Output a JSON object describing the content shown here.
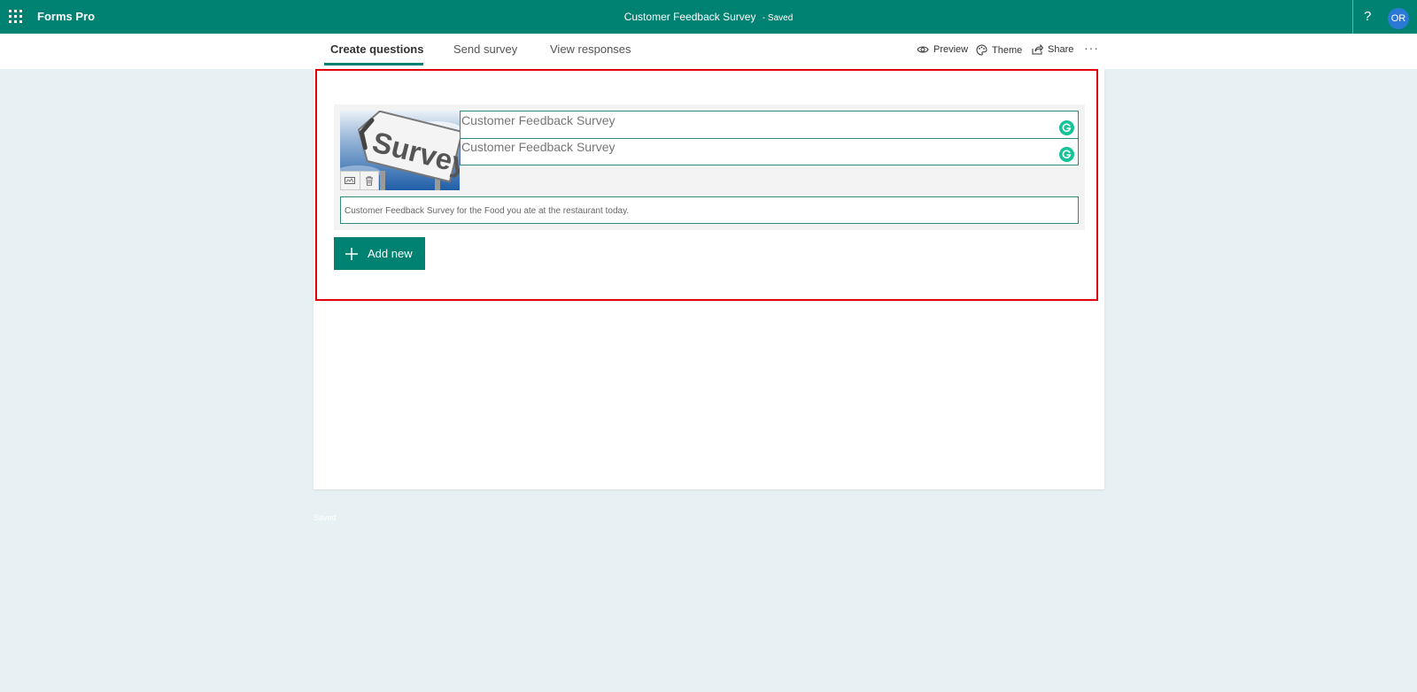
{
  "app": {
    "name": "Forms Pro"
  },
  "header": {
    "survey_title": "Customer Feedback Survey",
    "separator": "-",
    "save_status": "Saved"
  },
  "user": {
    "initials": "OR"
  },
  "help": {
    "label": "?"
  },
  "tabs": [
    {
      "label": "Create questions",
      "active": true
    },
    {
      "label": "Send survey",
      "active": false
    },
    {
      "label": "View responses",
      "active": false
    }
  ],
  "actions": {
    "preview": "Preview",
    "theme": "Theme",
    "share": "Share",
    "more": "···"
  },
  "survey": {
    "title": "Customer Feedback Survey",
    "subtitle": "Customer Feedback Survey",
    "description": "Customer Feedback Survey for the Food you ate at the restaurant today.",
    "cover_sign_text": "Survey"
  },
  "add_new_label": "Add new",
  "footer": {
    "status": "Saved"
  },
  "colors": {
    "brand": "#008272",
    "highlight": "#e0000a",
    "background": "#e7f0f2",
    "avatar": "#2a7ad5",
    "grammarly": "#15c39a"
  },
  "icons": [
    "app-launcher-icon",
    "eye-icon",
    "palette-icon",
    "share-icon",
    "edit-image-icon",
    "trash-icon",
    "plus-icon",
    "grammarly-icon"
  ]
}
